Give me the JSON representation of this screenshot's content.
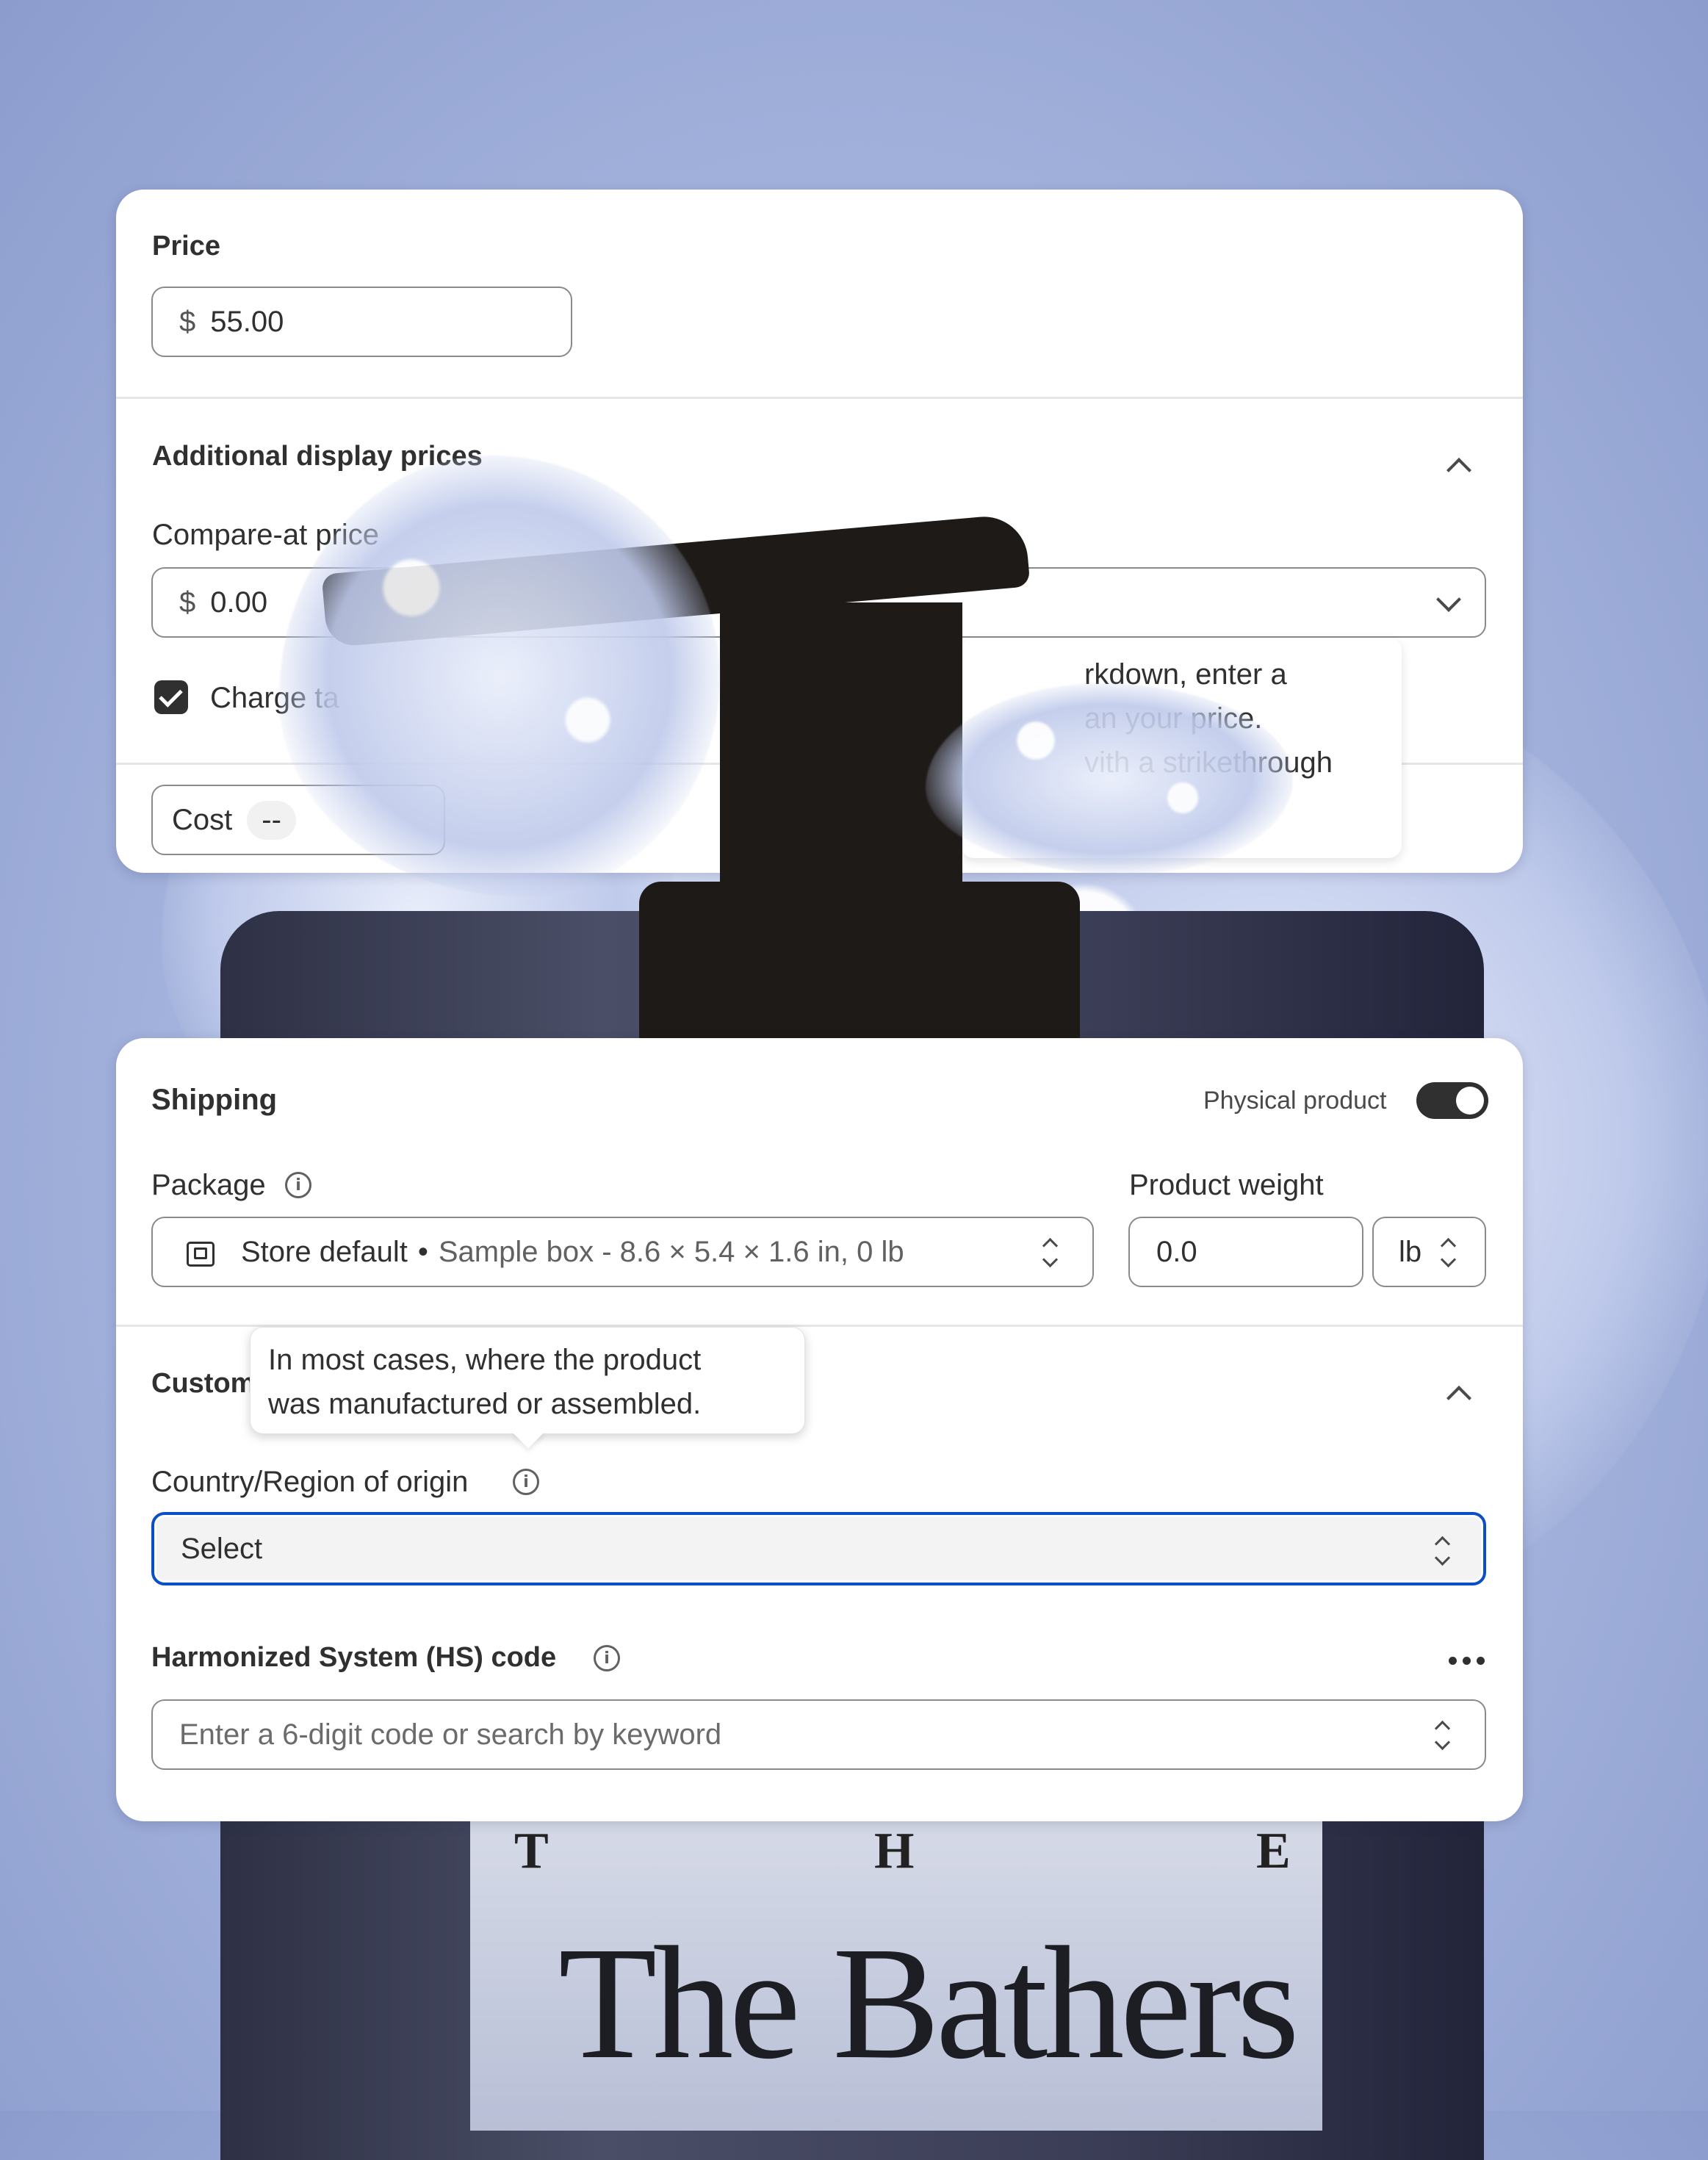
{
  "pricing": {
    "price_label": "Price",
    "currency_symbol": "$",
    "price_value": "55.00",
    "additional_prices_label": "Additional display prices",
    "compare_label": "Compare-at price",
    "compare_value": "0.00",
    "charge_tax_label": "Charge ta",
    "charge_tax_checked": true,
    "cost_label": "Cost",
    "cost_value": "--",
    "compare_tooltip": [
      "rkdown, enter a",
      "an your price.",
      "vith a strikethrough"
    ]
  },
  "shipping": {
    "title": "Shipping",
    "physical_product_label": "Physical product",
    "physical_product_on": true,
    "package_label": "Package",
    "package_name": "Store default",
    "package_separator": "•",
    "package_detail": "Sample box - 8.6 × 5.4 × 1.6 in, 0 lb",
    "weight_label": "Product weight",
    "weight_value": "0.0",
    "weight_unit": "lb",
    "customs_label": "Custom",
    "origin_tooltip": [
      "In most cases, where the product",
      "was manufactured or assembled."
    ],
    "origin_label": "Country/Region of origin",
    "origin_value": "Select",
    "hs_label": "Harmonized System (HS) code",
    "hs_placeholder": "Enter a 6-digit code or search by keyword"
  },
  "background": {
    "letter_1": "T",
    "letter_2": "H",
    "letter_3": "E",
    "brand_name": "The Bathers"
  },
  "colors": {
    "focus_ring": "#0b4fc4",
    "toggle_on": "#303030",
    "checkbox": "#303030"
  },
  "icons": [
    "info-icon",
    "package-box-icon",
    "chevron-up-icon",
    "chevron-down-icon",
    "select-stepper-icon",
    "more-horizontal-icon",
    "checkmark-icon"
  ]
}
